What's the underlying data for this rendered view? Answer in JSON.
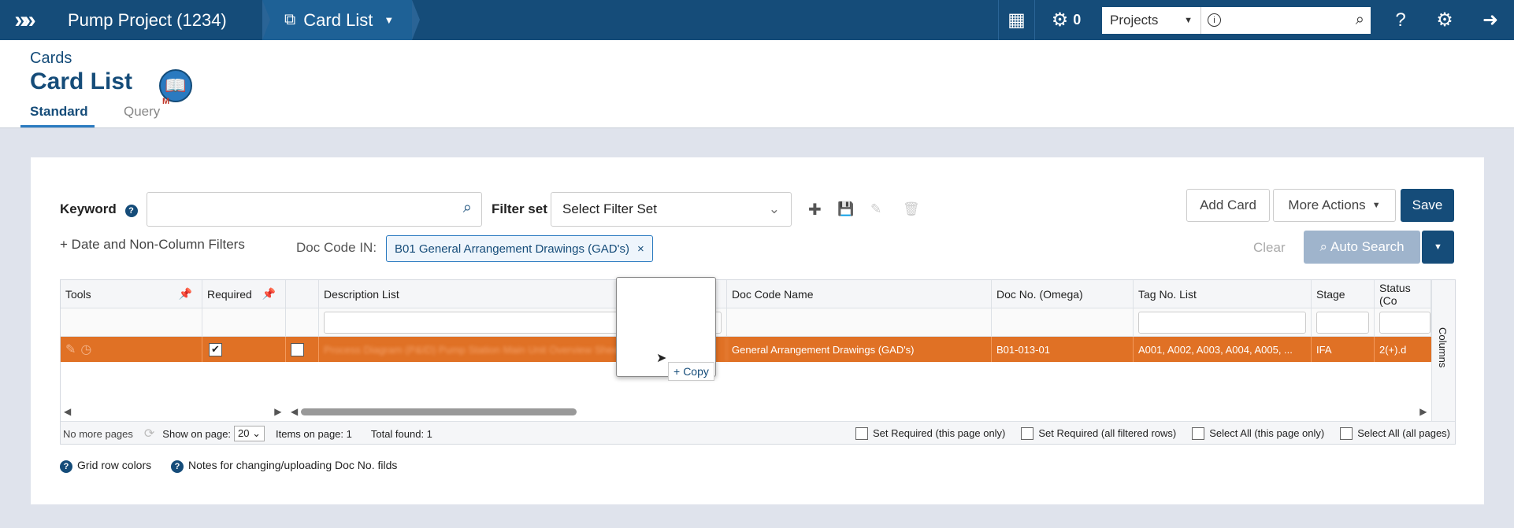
{
  "topbar": {
    "project": "Pump Project (1234)",
    "page": "Card List",
    "counter": "0",
    "project_select": "Projects",
    "search_placeholder": ""
  },
  "header": {
    "subtitle": "Cards",
    "title": "Card List",
    "badge": "M",
    "tabs": [
      "Standard",
      "Query"
    ]
  },
  "filters": {
    "keyword_label": "Keyword",
    "filter_set_label": "Filter set",
    "filter_set_value": "Select Filter Set",
    "date_filters_label": "Date and Non-Column Filters",
    "doc_code_label": "Doc Code IN:",
    "doc_code_chip": "B01 General Arrangement Drawings (GAD's)",
    "clear_label": "Clear"
  },
  "actions": {
    "add_card": "Add Card",
    "more_actions": "More Actions",
    "save": "Save",
    "auto_search": "Auto Search"
  },
  "grid": {
    "headers": [
      "Tools",
      "Required",
      "",
      "Description List",
      "Doc Code Name",
      "Doc No. (Omega)",
      "Tag No. List",
      "Stage",
      "Status (Co"
    ],
    "columns_label": "Columns",
    "row": {
      "description": "Process Diagram (P&ID) Pump Station Main Unit Overview Sheet 1 of 3",
      "doc_code_name": "General Arrangement Drawings (GAD's)",
      "doc_no": "B01-013-01",
      "tags": "A001, A002, A003, A004, A005, ...",
      "stage": "IFA",
      "status": "2(+).d"
    }
  },
  "pager": {
    "no_more_pages": "No more pages",
    "show_on_page_label": "Show on page:",
    "show_on_page_value": "20",
    "items_on_page": "Items on page: 1",
    "total_found": "Total found: 1",
    "set_required_page": "Set Required (this page only)",
    "set_required_all": "Set Required (all filtered rows)",
    "select_all_page": "Select All (this page only)",
    "select_all_pages": "Select All (all pages)"
  },
  "notes": {
    "row_colors": "Grid row colors",
    "doc_notes": "Notes for changing/uploading Doc No. filds"
  },
  "drag": {
    "copy_label": "Copy"
  }
}
